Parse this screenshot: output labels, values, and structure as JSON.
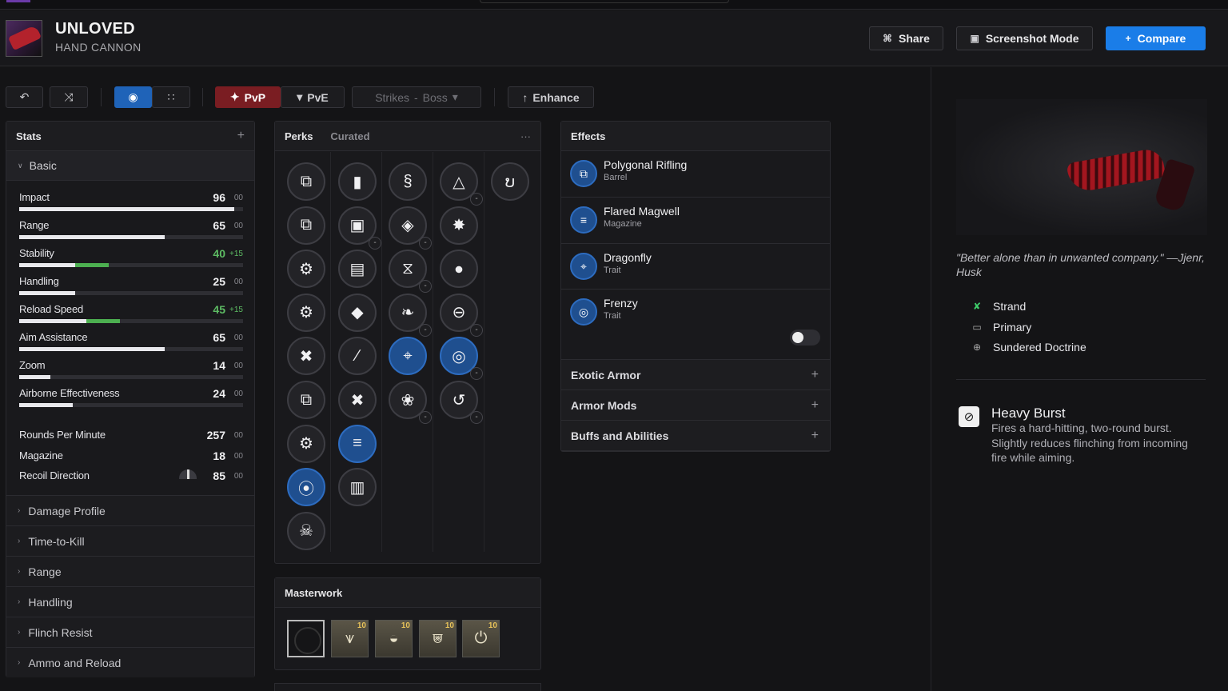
{
  "weapon": {
    "name": "UNLOVED",
    "type": "HAND CANNON"
  },
  "header": {
    "share": "Share",
    "screenshot_mode": "Screenshot Mode",
    "compare": "Compare"
  },
  "toolbar": {
    "pvp": "PvP",
    "pve": "PvE",
    "strikes": "Strikes",
    "boss": "Boss",
    "enhance": "Enhance"
  },
  "stats": {
    "title": "Stats",
    "basic": "Basic",
    "bars": [
      {
        "label": "Impact",
        "value": "96",
        "mod": "00",
        "fill": 0.96,
        "bonus": 0
      },
      {
        "label": "Range",
        "value": "65",
        "mod": "00",
        "fill": 0.65,
        "bonus": 0
      },
      {
        "label": "Stability",
        "value": "40",
        "mod": "+15",
        "fill": 0.25,
        "bonus": 0.15,
        "highlight": true
      },
      {
        "label": "Handling",
        "value": "25",
        "mod": "00",
        "fill": 0.25,
        "bonus": 0
      },
      {
        "label": "Reload Speed",
        "value": "45",
        "mod": "+15",
        "fill": 0.3,
        "bonus": 0.15,
        "highlight": true
      },
      {
        "label": "Aim Assistance",
        "value": "65",
        "mod": "00",
        "fill": 0.65,
        "bonus": 0
      },
      {
        "label": "Zoom",
        "value": "14",
        "mod": "00",
        "fill": 0.14,
        "bonus": 0
      },
      {
        "label": "Airborne Effectiveness",
        "value": "24",
        "mod": "00",
        "fill": 0.24,
        "bonus": 0
      }
    ],
    "plain": [
      {
        "label": "Rounds Per Minute",
        "value": "257",
        "mod": "00"
      },
      {
        "label": "Magazine",
        "value": "18",
        "mod": "00"
      },
      {
        "label": "Recoil Direction",
        "value": "85",
        "mod": "00"
      }
    ],
    "sections": [
      "Damage Profile",
      "Time-to-Kill",
      "Range",
      "Handling",
      "Flinch Resist",
      "Ammo and Reload"
    ]
  },
  "perks": {
    "tab_perks": "Perks",
    "tab_curated": "Curated",
    "more": "···",
    "columns": [
      [
        "⧉",
        "⧉",
        "⚙",
        "⚙",
        "✖",
        "⧉",
        "⚙",
        "⦿",
        "☠"
      ],
      [
        "▮",
        "▣",
        "▤",
        "◆",
        "∕",
        "✖",
        "≡",
        "▥"
      ],
      [
        "§",
        "◈",
        "⧖",
        "❧",
        "⌖",
        "❀"
      ],
      [
        "△",
        "✸",
        "⦁",
        "⊖",
        "◎",
        "↺"
      ],
      [
        "ບ"
      ]
    ],
    "selected": [
      "0-7",
      "1-6",
      "2-4",
      "3-4"
    ]
  },
  "masterwork": {
    "title": "Masterwork",
    "levels": [
      "10",
      "10",
      "10",
      "10"
    ]
  },
  "effects": {
    "title": "Effects",
    "items": [
      {
        "name": "Polygonal Rifling",
        "type": "Barrel"
      },
      {
        "name": "Flared Magwell",
        "type": "Magazine"
      },
      {
        "name": "Dragonfly",
        "type": "Trait"
      },
      {
        "name": "Frenzy",
        "type": "Trait"
      }
    ],
    "frenzy_toggle_on": false,
    "expanders": [
      "Exotic Armor",
      "Armor Mods",
      "Buffs and Abilities"
    ]
  },
  "info": {
    "quote": "\"Better alone than in unwanted company.\" —Jjenr, Husk",
    "tags": [
      "Strand",
      "Primary",
      "Sundered Doctrine"
    ],
    "frame_name": "Heavy Burst",
    "frame_desc": "Fires a hard-hitting, two-round burst. Slightly reduces flinching from incoming fire while aiming."
  },
  "colors": {
    "accent": "#1a7de8",
    "pvp": "#7a1d22",
    "selected_perk": "#1f4f8f",
    "bonus": "#4caf50",
    "strand": "#3fcf6b"
  }
}
